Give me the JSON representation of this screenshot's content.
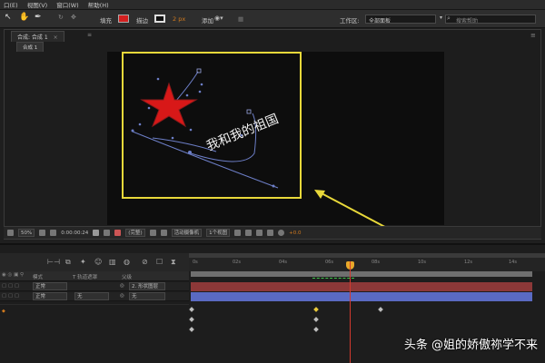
{
  "menubar": {
    "items": [
      "口(E)",
      "视图(V)",
      "窗口(W)",
      "帮助(H)"
    ]
  },
  "toolbar": {
    "fill_label": "填充",
    "stroke_label": "描边",
    "stroke_width": "2 px",
    "add_label": "添加",
    "workspace_label": "工作区:",
    "workspace_value": "全部面板",
    "search_placeholder": "搜索帮助",
    "fill_color": "#d32020",
    "accent_orange": "#d27a1e"
  },
  "composition": {
    "panel_tab": "合成: 合成 1",
    "breadcrumb": "合成 1",
    "canvas_text": "我和我的祖国"
  },
  "viewer_controls": {
    "zoom": "50%",
    "timecode": "0:00:00:24",
    "resolution": "(完整)",
    "camera": "活动摄像机",
    "views": "1个视图",
    "exposure": "+0.0"
  },
  "timeline": {
    "ruler_ticks": [
      "0s",
      "02s",
      "04s",
      "06s",
      "08s",
      "10s",
      "12s",
      "14s"
    ],
    "header": {
      "mode_col": "模式",
      "trkmat_col": "T  轨道遮罩",
      "parent_col": "父级"
    },
    "layers": [
      {
        "mode": "正常",
        "trkmat": "",
        "parent": "2. 形状图层"
      },
      {
        "mode": "正常",
        "trkmat": "无",
        "parent": "无"
      }
    ]
  },
  "watermark": "头条 @姐的娇傲祢学不来"
}
